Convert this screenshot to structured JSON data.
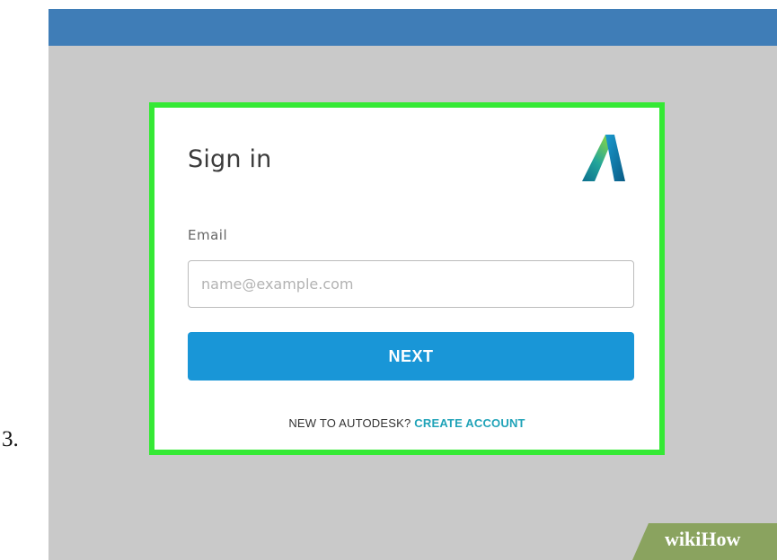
{
  "step_number": "3.",
  "signin": {
    "title": "Sign in",
    "logo_icon": "autodesk-logo-icon",
    "email_label": "Email",
    "email_value": "",
    "email_placeholder": "name@example.com",
    "next_label": "NEXT",
    "signup_prompt": "NEW TO AUTODESK?",
    "create_account_label": "CREATE ACCOUNT"
  },
  "watermark": {
    "brand_wiki": "wiki",
    "brand_how": "How"
  },
  "colors": {
    "topbar": "#3f7db7",
    "screen_background": "#c9c9c9",
    "highlight_border": "#35e935",
    "next_button": "#1996d7",
    "create_account_link": "#20a3b8",
    "watermark_background": "#8aa35f"
  }
}
